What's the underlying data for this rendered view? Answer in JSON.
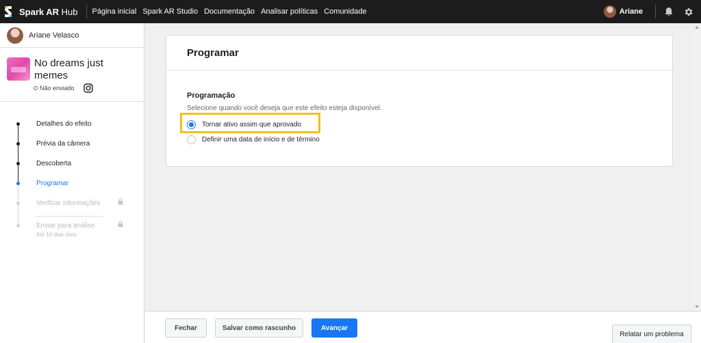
{
  "topbar": {
    "brand_bold": "Spark AR",
    "brand_light": " Hub",
    "nav": [
      "Página inicial",
      "Spark AR Studio",
      "Documentação",
      "Analisar políticas",
      "Comunidade"
    ],
    "user_name": "Ariane",
    "icons": {
      "logo": "spark-ar-logo",
      "notifications": "bell-icon",
      "settings": "gear-icon"
    }
  },
  "sidebar": {
    "user_name": "Ariane Velasco",
    "effect": {
      "title": "No dreams just memes",
      "status": "Não enviado",
      "platform_icon": "instagram-icon"
    },
    "steps": [
      {
        "label": "Detalhes do efeito",
        "state": "done"
      },
      {
        "label": "Prévia da câmera",
        "state": "done"
      },
      {
        "label": "Descoberta",
        "state": "done"
      },
      {
        "label": "Programar",
        "state": "active"
      },
      {
        "label": "Verificar informações",
        "state": "locked"
      },
      {
        "label": "Enviar para análise",
        "sub": "Até 10 dias úteis",
        "state": "locked"
      }
    ]
  },
  "main": {
    "title": "Programar",
    "section_title": "Programação",
    "section_desc": "Selecione quando você deseja que este efeito esteja disponível.",
    "options": [
      {
        "label": "Tornar ativo assim que aprovado",
        "selected": true
      },
      {
        "label": "Definir uma data de início e de término",
        "selected": false
      }
    ],
    "highlight_color": "#f4bf1a"
  },
  "footer": {
    "close_label": "Fechar",
    "draft_label": "Salvar como rascunho",
    "next_label": "Avançar",
    "report_label": "Relatar um problema"
  },
  "colors": {
    "accent": "#1877f2",
    "topbar": "#1c1c1c"
  }
}
